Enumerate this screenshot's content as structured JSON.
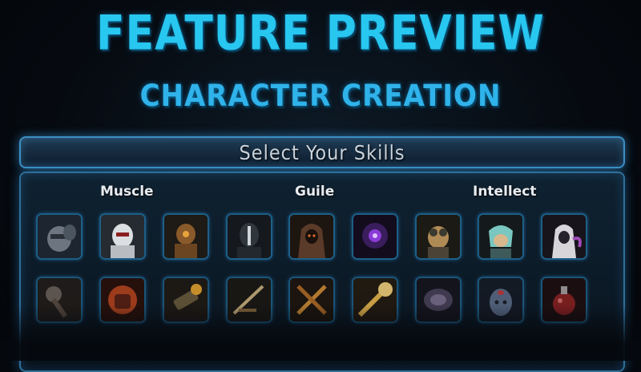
{
  "header": {
    "title": "FEATURE PREVIEW",
    "subtitle": "CHARACTER CREATION"
  },
  "banner": {
    "label": "Select Your Skills"
  },
  "categories": [
    {
      "label": "Muscle"
    },
    {
      "label": "Guile"
    },
    {
      "label": "Intellect"
    }
  ],
  "colors": {
    "title": "#27c7f0",
    "frame": "#3c8fc4",
    "panel_bg": "#0b1824"
  },
  "portraits": [
    {
      "icon": "armored-warrior-portrait-icon"
    },
    {
      "icon": "white-armored-soldier-portrait-icon"
    },
    {
      "icon": "bronze-robot-portrait-icon"
    },
    {
      "icon": "dark-mask-portrait-icon"
    },
    {
      "icon": "hooded-figure-portrait-icon"
    },
    {
      "icon": "purple-mage-portrait-icon"
    },
    {
      "icon": "goggled-engineer-portrait-icon"
    },
    {
      "icon": "teal-robot-portrait-icon"
    },
    {
      "icon": "white-hooded-mystic-portrait-icon"
    }
  ],
  "skills": [
    {
      "icon": "spiked-mace-icon"
    },
    {
      "icon": "fire-fist-icon"
    },
    {
      "icon": "power-gauntlet-icon"
    },
    {
      "icon": "sword-slash-icon"
    },
    {
      "icon": "crossed-blades-icon"
    },
    {
      "icon": "golden-strike-icon"
    },
    {
      "icon": "energy-shield-icon"
    },
    {
      "icon": "third-eye-mind-icon"
    },
    {
      "icon": "red-potion-icon"
    }
  ]
}
